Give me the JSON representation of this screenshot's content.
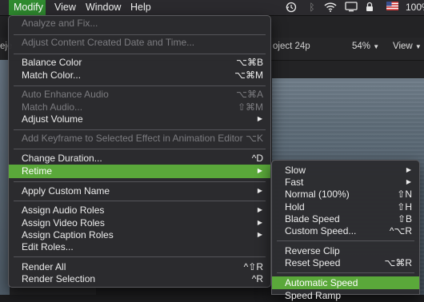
{
  "menubar": {
    "items": [
      "Modify",
      "View",
      "Window",
      "Help"
    ],
    "active": "Modify",
    "status_right_text": "100%"
  },
  "app": {
    "left_title_fragment": "eje",
    "project_title": "oject 24p",
    "zoom": "54%",
    "view_label": "View"
  },
  "modify_menu": {
    "items": [
      {
        "label": "Analyze and Fix...",
        "shortcut": "",
        "disabled": true
      },
      {
        "label": "Adjust Content Created Date and Time...",
        "shortcut": "",
        "disabled": true
      },
      {
        "label": "Balance Color",
        "shortcut": "⌥⌘B",
        "disabled": false
      },
      {
        "label": "Match Color...",
        "shortcut": "⌥⌘M",
        "disabled": false
      },
      {
        "label": "Auto Enhance Audio",
        "shortcut": "⌥⌘A",
        "disabled": true
      },
      {
        "label": "Match Audio...",
        "shortcut": "⇧⌘M",
        "disabled": true
      },
      {
        "label": "Adjust Volume",
        "shortcut": "",
        "disabled": false
      },
      {
        "label": "Add Keyframe to Selected Effect in Animation Editor",
        "shortcut": "⌥K",
        "disabled": true
      },
      {
        "label": "Change Duration...",
        "shortcut": "^D",
        "disabled": false
      },
      {
        "label": "Retime",
        "shortcut": "",
        "disabled": false
      },
      {
        "label": "Apply Custom Name",
        "shortcut": "",
        "disabled": false
      },
      {
        "label": "Assign Audio Roles",
        "shortcut": "",
        "disabled": false
      },
      {
        "label": "Assign Video Roles",
        "shortcut": "",
        "disabled": false
      },
      {
        "label": "Assign Caption Roles",
        "shortcut": "",
        "disabled": false
      },
      {
        "label": "Edit Roles...",
        "shortcut": "",
        "disabled": false
      },
      {
        "label": "Render All",
        "shortcut": "^⇧R",
        "disabled": false
      },
      {
        "label": "Render Selection",
        "shortcut": "^R",
        "disabled": false
      }
    ]
  },
  "retime_menu": {
    "items": [
      {
        "label": "Slow",
        "shortcut": ""
      },
      {
        "label": "Fast",
        "shortcut": ""
      },
      {
        "label": "Normal (100%)",
        "shortcut": "⇧N"
      },
      {
        "label": "Hold",
        "shortcut": "⇧H"
      },
      {
        "label": "Blade Speed",
        "shortcut": "⇧B"
      },
      {
        "label": "Custom Speed...",
        "shortcut": "^⌥R"
      },
      {
        "label": "Reverse Clip",
        "shortcut": ""
      },
      {
        "label": "Reset Speed",
        "shortcut": "⌥⌘R"
      },
      {
        "label": "Automatic Speed",
        "shortcut": ""
      },
      {
        "label": "Speed Ramp",
        "shortcut": ""
      }
    ]
  },
  "colors": {
    "highlight": "#5aa83a",
    "menubar_active": "#2f8a2f"
  }
}
